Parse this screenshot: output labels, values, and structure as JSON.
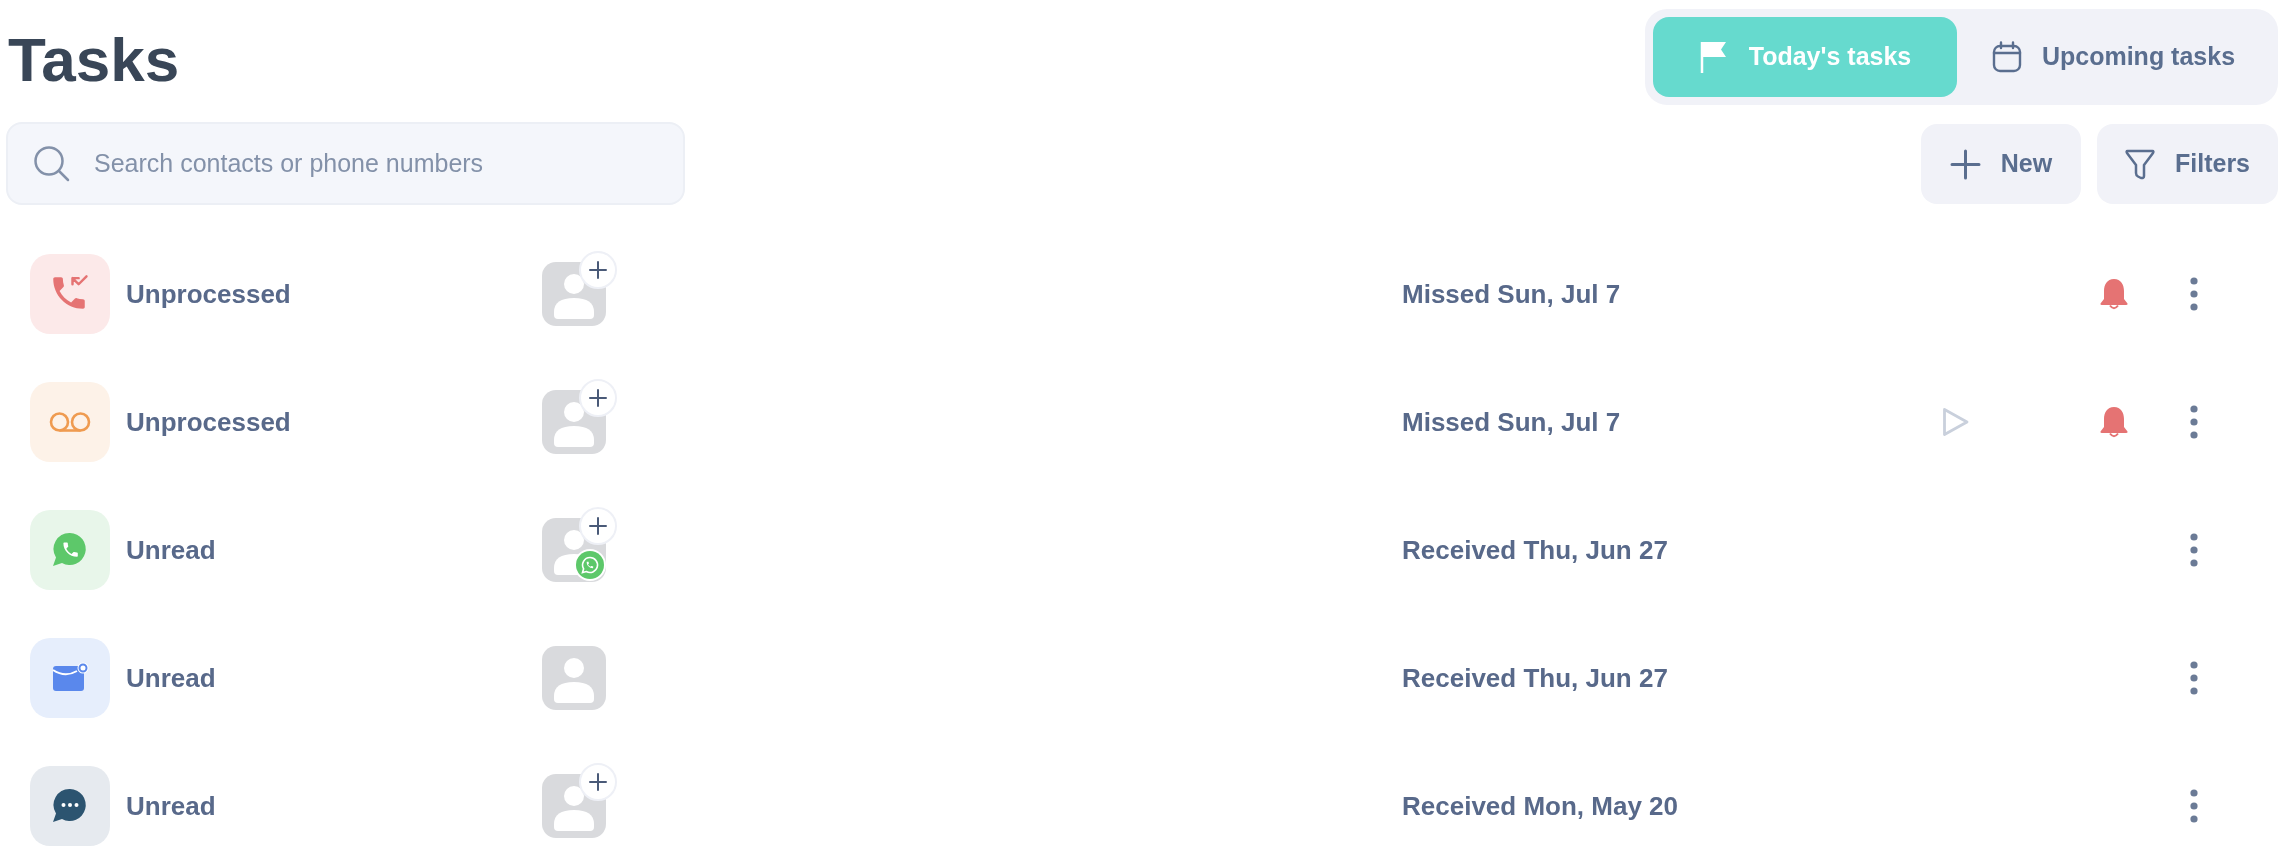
{
  "page": {
    "title": "Tasks"
  },
  "search": {
    "placeholder": "Search contacts or phone numbers"
  },
  "tabs": [
    {
      "label": "Today's tasks",
      "selected": true
    },
    {
      "label": "Upcoming tasks",
      "selected": false
    }
  ],
  "actions": [
    {
      "label": "New"
    },
    {
      "label": "Filters"
    }
  ],
  "tasks": [
    {
      "kind": "missed_call",
      "status": "Unprocessed",
      "add_contact": true,
      "whatsapp_badge": false,
      "date": "Missed Sun, Jul 7",
      "play": false,
      "reminder": true
    },
    {
      "kind": "voicemail",
      "status": "Unprocessed",
      "add_contact": true,
      "whatsapp_badge": false,
      "date": "Missed Sun, Jul 7",
      "play": true,
      "reminder": true
    },
    {
      "kind": "whatsapp",
      "status": "Unread",
      "add_contact": true,
      "whatsapp_badge": true,
      "date": "Received Thu, Jun 27",
      "play": false,
      "reminder": false
    },
    {
      "kind": "email",
      "status": "Unread",
      "add_contact": false,
      "whatsapp_badge": false,
      "date": "Received Thu, Jun 27",
      "play": false,
      "reminder": false
    },
    {
      "kind": "chat",
      "status": "Unread",
      "add_contact": true,
      "whatsapp_badge": false,
      "date": "Received Mon, May 20",
      "play": false,
      "reminder": false
    }
  ]
}
